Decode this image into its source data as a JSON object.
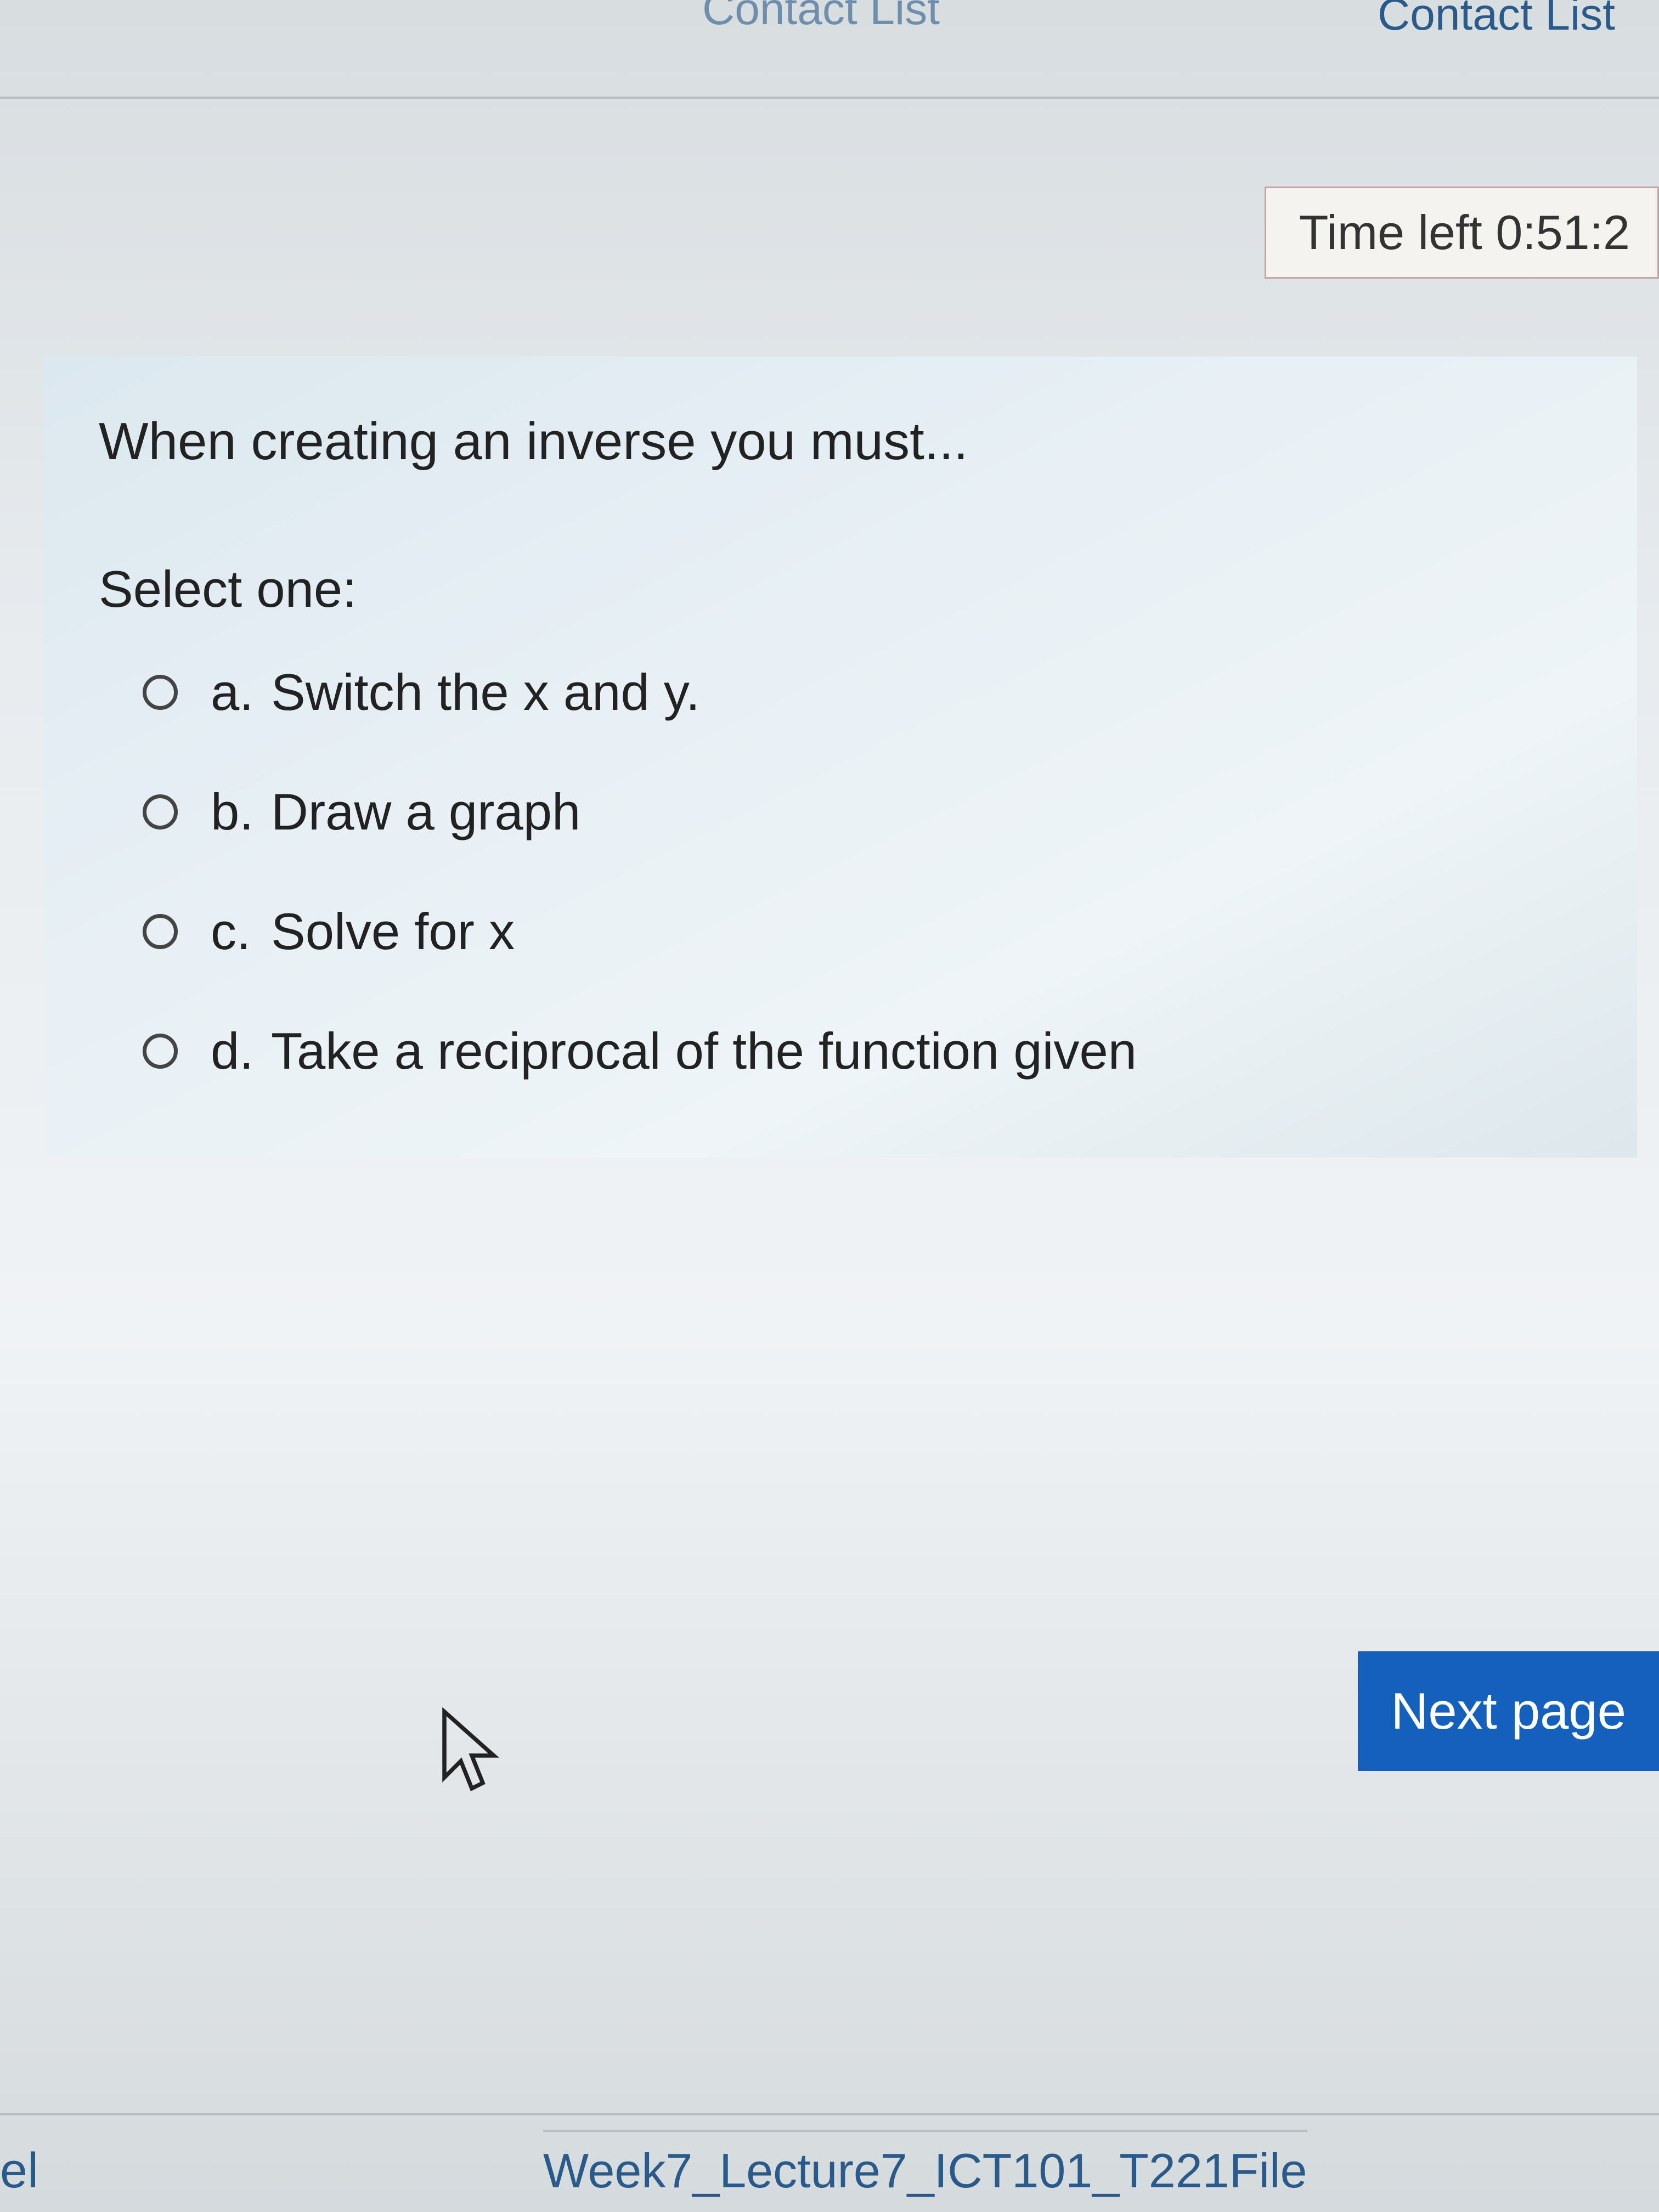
{
  "nav": {
    "partial_item": "Contact List",
    "contact_list": "Contact List"
  },
  "timer": {
    "label": "Time left 0:51:2"
  },
  "question": {
    "text": "When creating an inverse you must...",
    "select_one": "Select one:",
    "options": [
      {
        "letter": "a.",
        "text": "Switch the x and y."
      },
      {
        "letter": "b.",
        "text": "Draw a graph"
      },
      {
        "letter": "c.",
        "text": "Solve for x"
      },
      {
        "letter": "d.",
        "text": "Take a reciprocal of the function given"
      }
    ]
  },
  "buttons": {
    "next": "Next page"
  },
  "bottom": {
    "left_partial": "lel",
    "file": "Week7_Lecture7_ICT101_T221File"
  }
}
